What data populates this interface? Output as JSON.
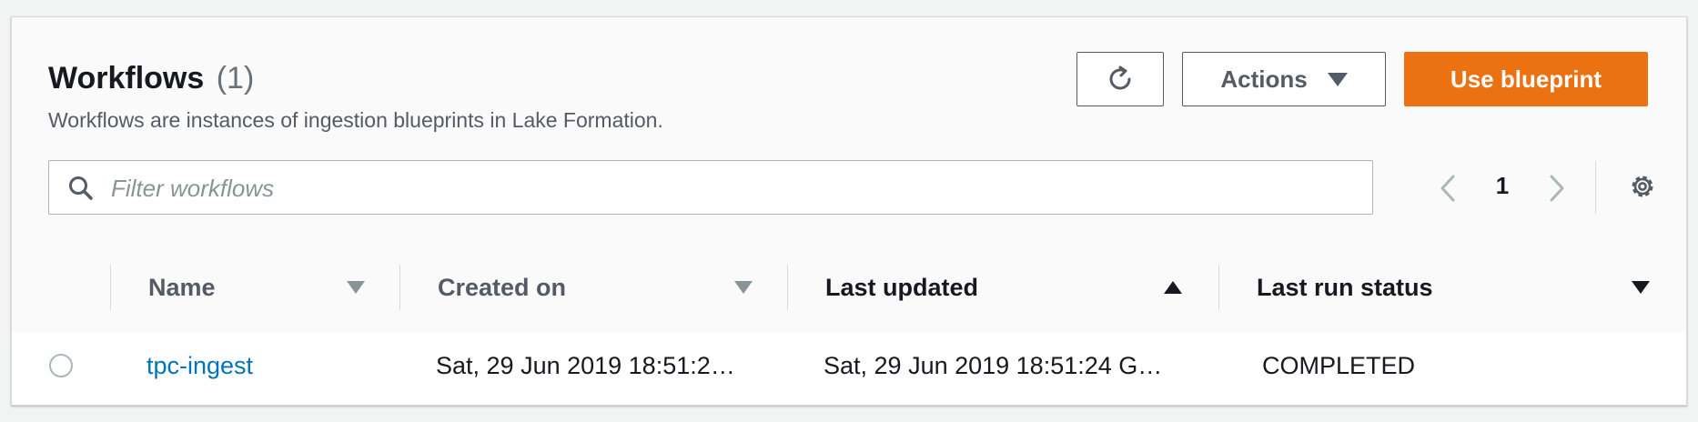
{
  "header": {
    "title": "Workflows",
    "count": "(1)",
    "description": "Workflows are instances of ingestion blueprints in Lake Formation."
  },
  "toolbar": {
    "refresh_icon": "refresh-icon",
    "actions_label": "Actions",
    "use_blueprint_label": "Use blueprint",
    "primary_color": "#ec7211"
  },
  "search": {
    "placeholder": "Filter workflows",
    "value": ""
  },
  "pagination": {
    "current_page": "1"
  },
  "table": {
    "columns": [
      {
        "label": "Name",
        "sort": "none"
      },
      {
        "label": "Created on",
        "sort": "none"
      },
      {
        "label": "Last updated",
        "sort": "ascending"
      },
      {
        "label": "Last run status",
        "sort": "descending"
      }
    ],
    "rows": [
      {
        "name": "tpc-ingest",
        "created_on": "Sat, 29 Jun 2019 18:51:2…",
        "last_updated": "Sat, 29 Jun 2019 18:51:24 G…",
        "last_run_status": "COMPLETED"
      }
    ]
  }
}
